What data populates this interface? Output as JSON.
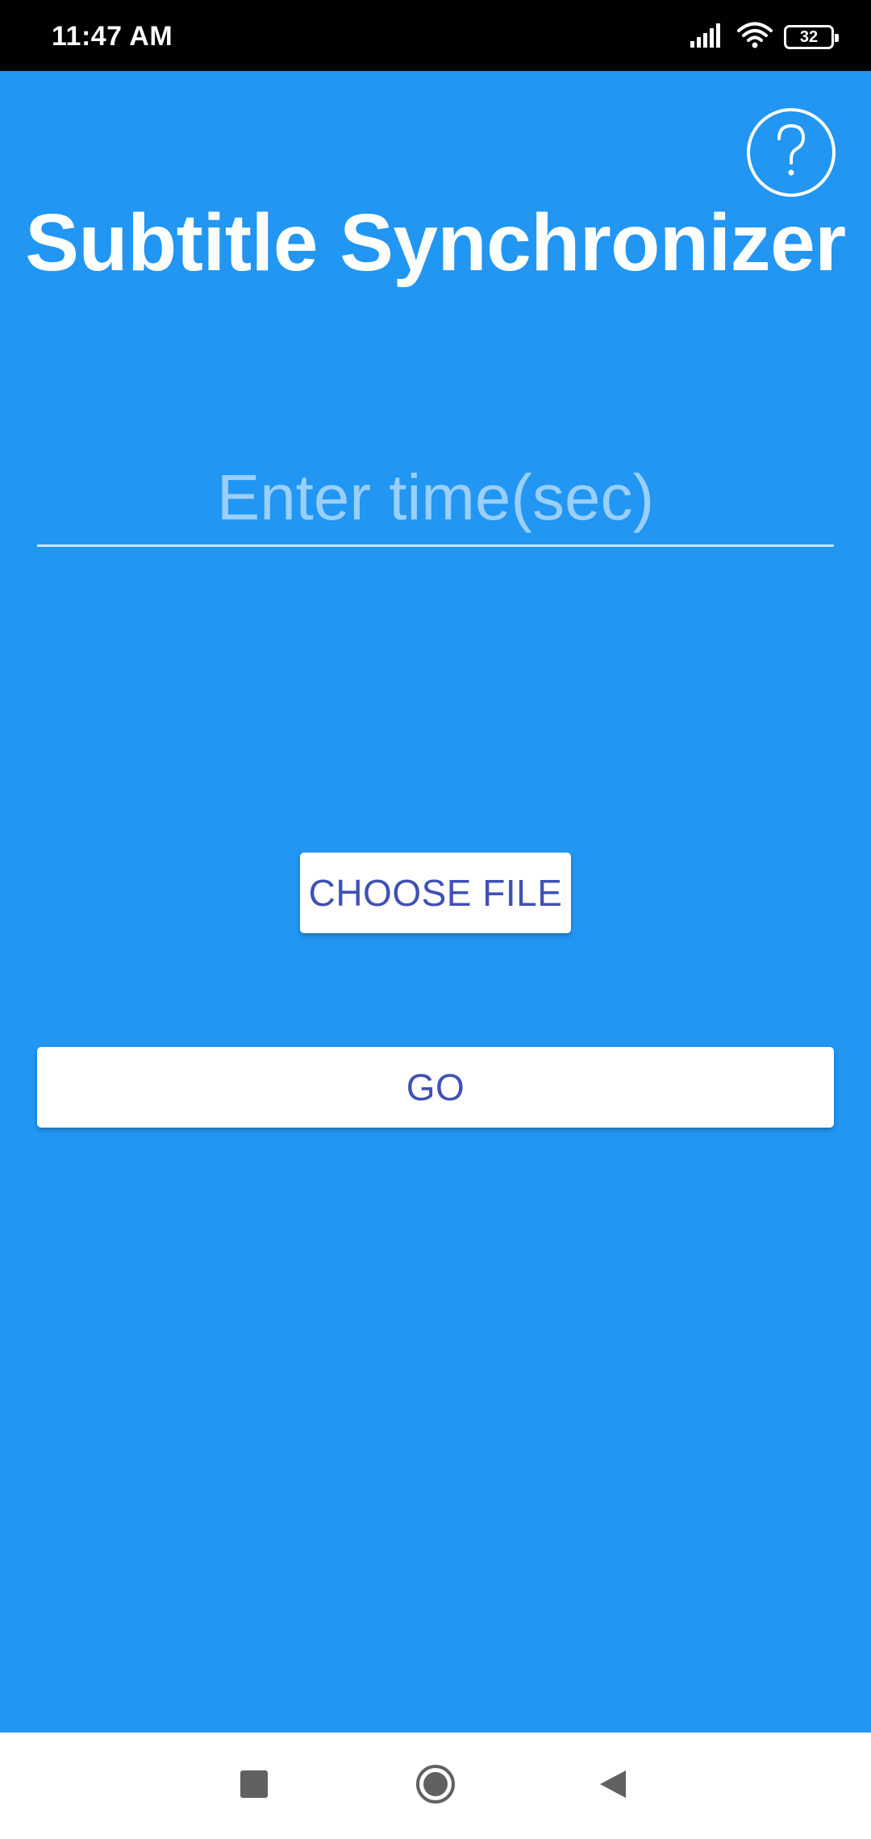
{
  "status_bar": {
    "time": "11:47 AM",
    "battery_level": "32",
    "icons": [
      "signal-icon",
      "wifi-icon",
      "battery-icon"
    ]
  },
  "app": {
    "title": "Subtitle Synchronizer",
    "help_icon": "help-circle-icon",
    "time_input": {
      "placeholder": "Enter time(sec)",
      "value": ""
    },
    "choose_file_label": "CHOOSE FILE",
    "go_label": "GO"
  },
  "colors": {
    "background": "#2196F3",
    "button_text": "#3F51B5",
    "button_background": "#FFFFFF"
  },
  "nav_bar": {
    "buttons": [
      "recents-icon",
      "home-icon",
      "back-icon"
    ]
  }
}
